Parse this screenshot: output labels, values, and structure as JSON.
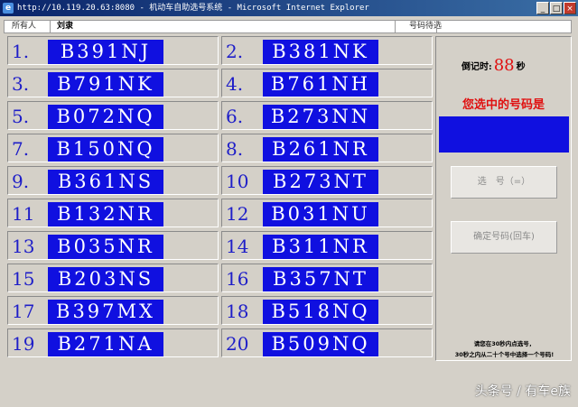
{
  "window": {
    "title": "http://10.119.20.63:8080 - 机动车自助选号系统 - Microsoft Internet Explorer",
    "icon_label": "e",
    "minimize": "_",
    "maximize": "□",
    "close": "×"
  },
  "header": {
    "owner_label": "所有人",
    "owner_name": "刘隶",
    "selected_label": "号码待选"
  },
  "plates": [
    {
      "num": "1.",
      "plate": "B391NJ"
    },
    {
      "num": "2.",
      "plate": "B381NK"
    },
    {
      "num": "3.",
      "plate": "B791NK"
    },
    {
      "num": "4.",
      "plate": "B761NH"
    },
    {
      "num": "5.",
      "plate": "B072NQ"
    },
    {
      "num": "6.",
      "plate": "B273NN"
    },
    {
      "num": "7.",
      "plate": "B150NQ"
    },
    {
      "num": "8.",
      "plate": "B261NR"
    },
    {
      "num": "9.",
      "plate": "B361NS"
    },
    {
      "num": "10",
      "plate": "B273NT"
    },
    {
      "num": "11",
      "plate": "B132NR"
    },
    {
      "num": "12",
      "plate": "B031NU"
    },
    {
      "num": "13",
      "plate": "B035NR"
    },
    {
      "num": "14",
      "plate": "B311NR"
    },
    {
      "num": "15",
      "plate": "B203NS"
    },
    {
      "num": "16",
      "plate": "B357NT"
    },
    {
      "num": "17",
      "plate": "B397MX"
    },
    {
      "num": "18",
      "plate": "B518NQ"
    },
    {
      "num": "19",
      "plate": "B271NA"
    },
    {
      "num": "20",
      "plate": "B509NQ"
    }
  ],
  "panel": {
    "countdown_label": "倒记时:",
    "countdown_value": "88",
    "countdown_unit": "秒",
    "prompt": "您选中的号码是",
    "select_button": "选　号（=）",
    "confirm_button": "确定号码(回车)",
    "note_line1": "请您在30秒内点选号，",
    "note_line2": "30秒之内从二十个号中选择一个号码!"
  },
  "watermark": "头条号 / 有车e族",
  "colors": {
    "plate_bg": "#1010e0",
    "number_text": "#1e1ec8",
    "alert_red": "#e01010"
  }
}
